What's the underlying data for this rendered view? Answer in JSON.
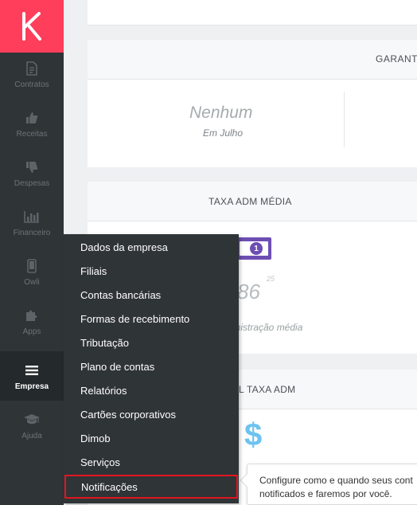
{
  "sidebar": {
    "logo_icon": "k-logo-icon",
    "brand_color": "#ff3e5b",
    "items": [
      {
        "label": "Contratos",
        "icon": "document-icon"
      },
      {
        "label": "Receitas",
        "icon": "thumbs-up-icon"
      },
      {
        "label": "Despesas",
        "icon": "thumbs-down-icon"
      },
      {
        "label": "Financeiro",
        "icon": "bar-chart-icon"
      },
      {
        "label": "Owli",
        "icon": "phone-icon"
      },
      {
        "label": "Apps",
        "icon": "puzzle-icon"
      },
      {
        "label": "Empresa",
        "icon": "menu-icon",
        "active": true
      },
      {
        "label": "Ajuda",
        "icon": "graduation-cap-icon"
      }
    ]
  },
  "main": {
    "garant": {
      "title": "GARANT",
      "value": "Nenhum",
      "period": "Em Julho"
    },
    "taxa": {
      "title": "TAXA ADM MÉDIA",
      "value": "86",
      "superscript": "25",
      "subtitle": "ministração média"
    },
    "total": {
      "title": "L TAXA ADM"
    }
  },
  "menu": {
    "items": [
      "Dados da empresa",
      "Filiais",
      "Contas bancárias",
      "Formas de recebimento",
      "Tributação",
      "Plano de contas",
      "Relatórios",
      "Cartões corporativos",
      "Dimob",
      "Serviços",
      "Notificações"
    ],
    "highlighted": "Notificações",
    "highlight_color": "#e0161f"
  },
  "tooltip": {
    "line1": "Configure como e quando seus cont",
    "line2": "notificados e faremos por você."
  }
}
